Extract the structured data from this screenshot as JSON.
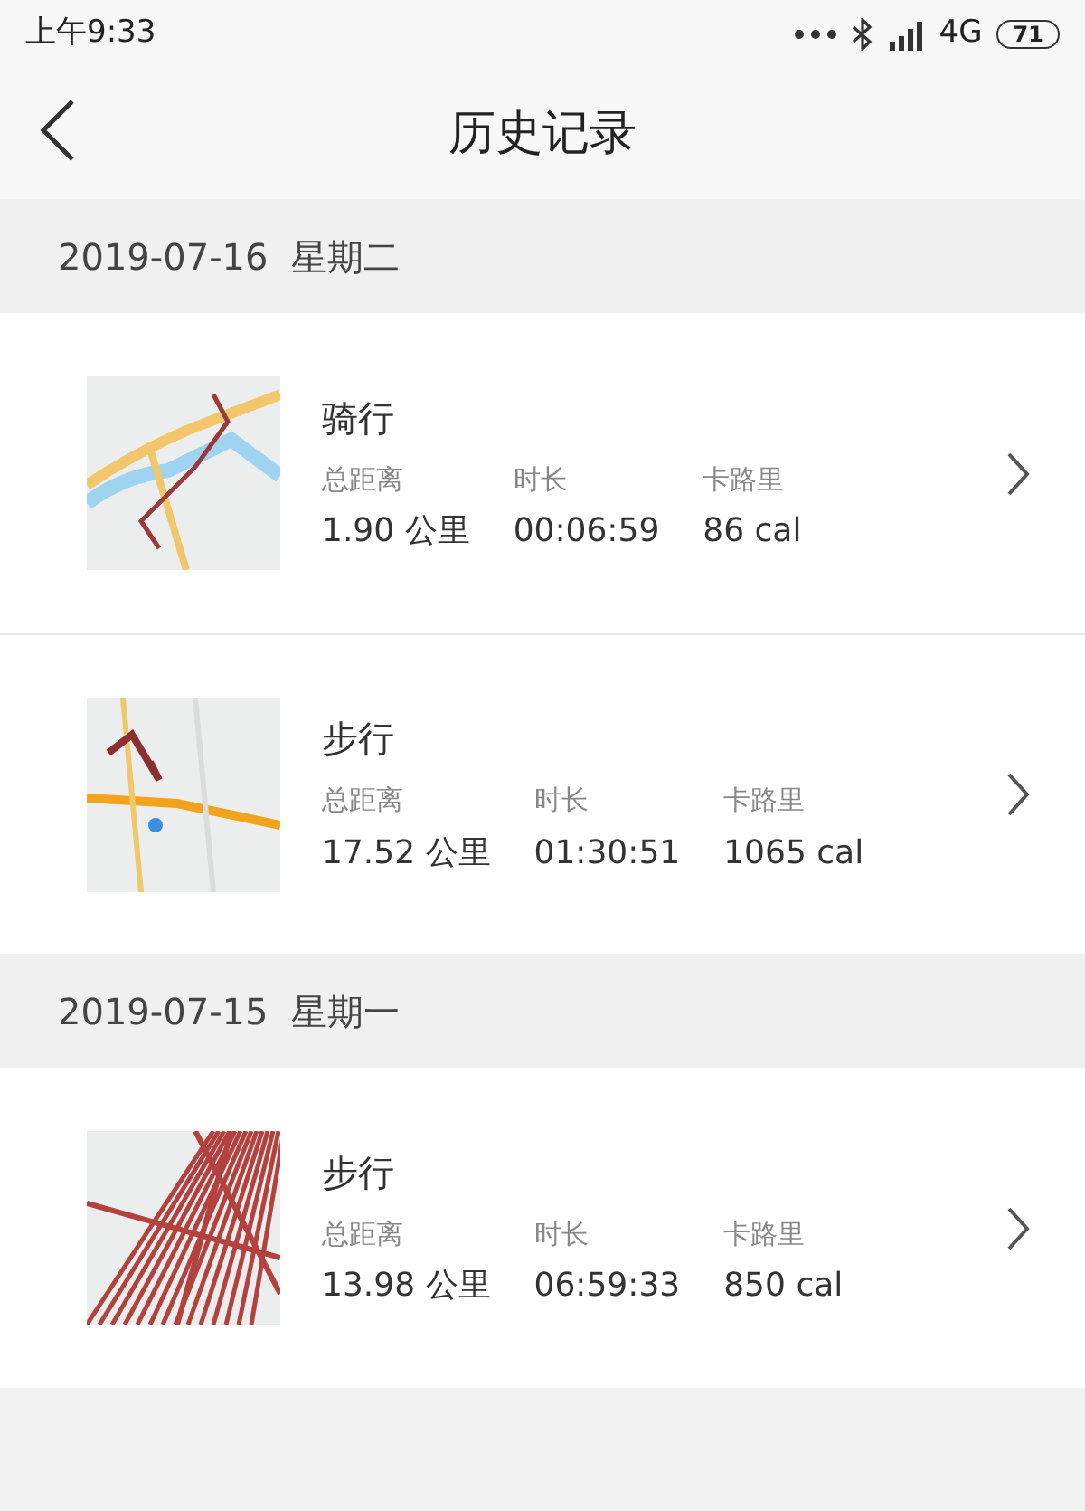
{
  "status_bar": {
    "time": "上午9:33",
    "network": "4G",
    "battery": "71"
  },
  "header": {
    "title": "历史记录"
  },
  "groups": [
    {
      "date": "2019-07-16  星期二",
      "records": [
        {
          "activity": "骑行",
          "stats": [
            {
              "label": "总距离",
              "value": "1.90 公里"
            },
            {
              "label": "时长",
              "value": "00:06:59"
            },
            {
              "label": "卡路里",
              "value": "86 cal"
            }
          ]
        },
        {
          "activity": "步行",
          "stats": [
            {
              "label": "总距离",
              "value": "17.52 公里"
            },
            {
              "label": "时长",
              "value": "01:30:51"
            },
            {
              "label": "卡路里",
              "value": "1065 cal"
            }
          ]
        }
      ]
    },
    {
      "date": "2019-07-15  星期一",
      "records": [
        {
          "activity": "步行",
          "stats": [
            {
              "label": "总距离",
              "value": "13.98 公里"
            },
            {
              "label": "时长",
              "value": "06:59:33"
            },
            {
              "label": "卡路里",
              "value": "850 cal"
            }
          ]
        }
      ]
    }
  ]
}
